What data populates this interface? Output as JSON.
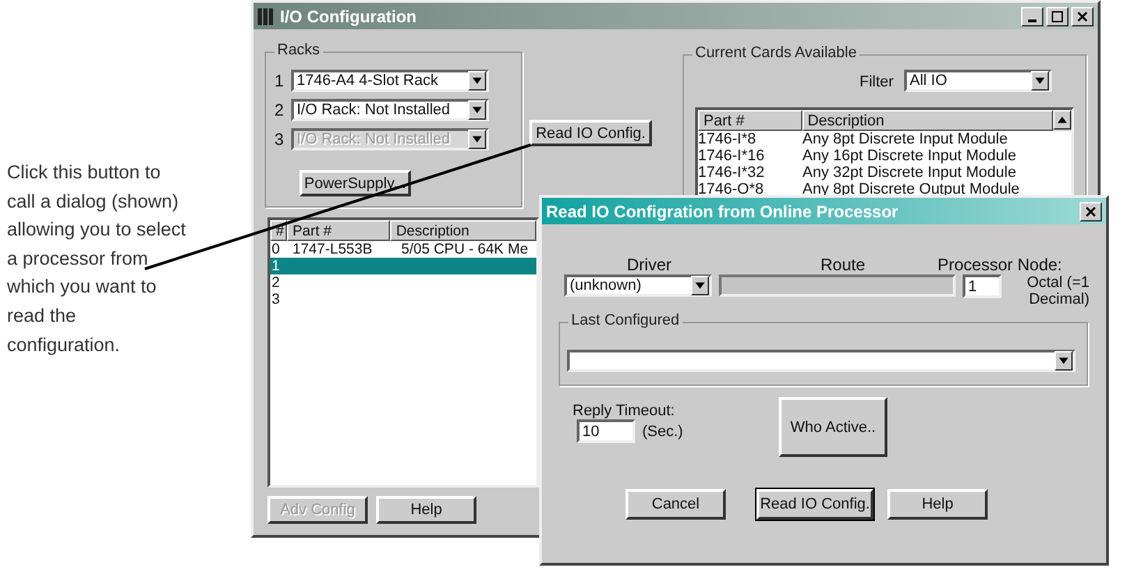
{
  "annotation": {
    "lines": [
      "Click this button to",
      "call a dialog (shown)",
      "allowing you to select",
      "a processor from",
      "which you want to",
      "read the",
      "configuration."
    ]
  },
  "main_window": {
    "title": "I/O Configuration",
    "racks": {
      "label": "Racks",
      "slots": [
        {
          "number": "1",
          "value": "1746-A4  4-Slot Rack",
          "disabled": false
        },
        {
          "number": "2",
          "value": "I/O Rack: Not Installed",
          "disabled": false
        },
        {
          "number": "3",
          "value": "I/O Rack: Not Installed",
          "disabled": true
        }
      ],
      "power_supply_button": "PowerSupply..."
    },
    "read_button": "Read IO Config.",
    "cards": {
      "label": "Current Cards Available",
      "filter_label": "Filter",
      "filter_value": "All IO",
      "columns": [
        "Part #",
        "Description"
      ],
      "rows": [
        {
          "part": "1746-I*8",
          "description": "Any 8pt  Discrete Input Module"
        },
        {
          "part": "1746-I*16",
          "description": "Any 16pt Discrete Input Module"
        },
        {
          "part": "1746-I*32",
          "description": "Any 32pt Discrete Input Module"
        },
        {
          "part": "1746-O*8",
          "description": "Any 8pt Discrete Output Module"
        }
      ]
    },
    "chassis": {
      "columns": [
        "#",
        "Part #",
        "Description"
      ],
      "rows": [
        {
          "slot": "0",
          "part": "1747-L553B",
          "description": "5/05 CPU - 64K Me",
          "selected": false
        },
        {
          "slot": "1",
          "selected": true
        },
        {
          "slot": "2",
          "selected": false
        },
        {
          "slot": "3",
          "selected": false
        }
      ]
    },
    "buttons": [
      {
        "label": "Adv Config",
        "disabled": true
      },
      {
        "label": "Help",
        "disabled": false
      }
    ]
  },
  "dialog": {
    "title": "Read IO Configration from Online Processor",
    "driver_label": "Driver",
    "driver_value": "(unknown)",
    "route_label": "Route",
    "node_label": "Processor Node:",
    "node_value": "1",
    "node_note": "Octal (=1 Decimal)",
    "last_configured_label": "Last Configured",
    "timeout_label": "Reply Timeout:",
    "timeout_value": "10",
    "timeout_unit": "(Sec.)",
    "who_active_button": "Who Active..",
    "buttons": [
      {
        "label": "Cancel",
        "default": false
      },
      {
        "label": "Read IO Config.",
        "default": true
      },
      {
        "label": "Help",
        "default": false
      }
    ]
  }
}
